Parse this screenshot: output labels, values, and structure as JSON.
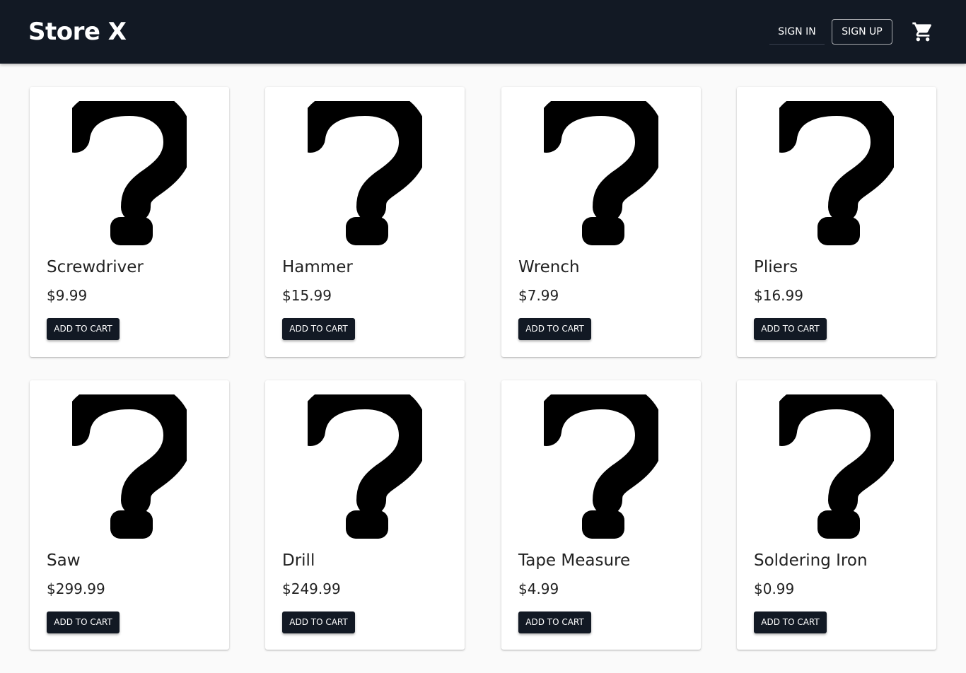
{
  "header": {
    "brand": "Store X",
    "sign_in_label": "SIGN IN",
    "sign_up_label": "SIGN UP",
    "cart_icon": "shopping-cart-icon"
  },
  "products": [
    {
      "name": "Screwdriver",
      "price": "$9.99",
      "image_icon": "question-mark-icon",
      "add_label": "ADD TO CART"
    },
    {
      "name": "Hammer",
      "price": "$15.99",
      "image_icon": "question-mark-icon",
      "add_label": "ADD TO CART"
    },
    {
      "name": "Wrench",
      "price": "$7.99",
      "image_icon": "question-mark-icon",
      "add_label": "ADD TO CART"
    },
    {
      "name": "Pliers",
      "price": "$16.99",
      "image_icon": "question-mark-icon",
      "add_label": "ADD TO CART"
    },
    {
      "name": "Saw",
      "price": "$299.99",
      "image_icon": "question-mark-icon",
      "add_label": "ADD TO CART"
    },
    {
      "name": "Drill",
      "price": "$249.99",
      "image_icon": "question-mark-icon",
      "add_label": "ADD TO CART"
    },
    {
      "name": "Tape Measure",
      "price": "$4.99",
      "image_icon": "question-mark-icon",
      "add_label": "ADD TO CART"
    },
    {
      "name": "Soldering Iron",
      "price": "$0.99",
      "image_icon": "question-mark-icon",
      "add_label": "ADD TO CART"
    }
  ],
  "colors": {
    "header_bg": "#121924",
    "page_bg": "#fafafa",
    "button_bg": "#121924"
  }
}
